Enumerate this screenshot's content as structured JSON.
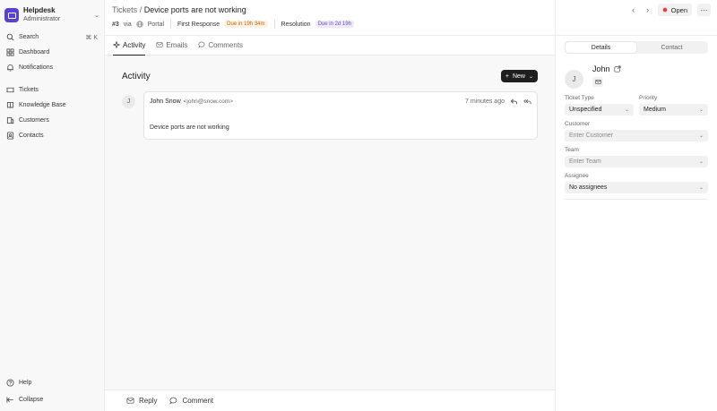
{
  "sidebar": {
    "brand_name": "Helpdesk",
    "brand_role": "Administrator",
    "search_label": "Search",
    "search_shortcut": "⌘ K",
    "items": [
      {
        "label": "Dashboard",
        "icon": "dashboard-icon"
      },
      {
        "label": "Notifications",
        "icon": "bell-icon"
      },
      {
        "label": "Tickets",
        "icon": "ticket-icon"
      },
      {
        "label": "Knowledge Base",
        "icon": "book-icon"
      },
      {
        "label": "Customers",
        "icon": "building-icon"
      },
      {
        "label": "Contacts",
        "icon": "contact-icon"
      }
    ],
    "help_label": "Help",
    "collapse_label": "Collapse"
  },
  "header": {
    "crumb_parent": "Tickets",
    "crumb_separator": "/",
    "crumb_title": "Device ports are not working",
    "ticket_no": "#3",
    "via": "via",
    "channel": "Portal",
    "first_response_label": "First Response",
    "first_response_due": "Due in 19h 34m",
    "resolution_label": "Resolution",
    "resolution_due": "Due in 2d 19h"
  },
  "tabs": [
    {
      "label": "Activity",
      "active": true
    },
    {
      "label": "Emails",
      "active": false
    },
    {
      "label": "Comments",
      "active": false
    }
  ],
  "activity": {
    "title": "Activity",
    "new_label": "New",
    "entry": {
      "avatar": "J",
      "name": "John Snow",
      "email": "<john@snow.com>",
      "time": "7 minutes ago",
      "body": "Device ports are not working"
    }
  },
  "reply_bar": {
    "reply_label": "Reply",
    "comment_label": "Comment"
  },
  "right": {
    "status_label": "Open",
    "status_color": "#d63b3b",
    "seg_details": "Details",
    "seg_contact": "Contact",
    "contact_avatar": "J",
    "contact_name": "John",
    "fields": {
      "ticket_type_label": "Ticket Type",
      "ticket_type_value": "Unspecified",
      "priority_label": "Priority",
      "priority_value": "Medium",
      "customer_label": "Customer",
      "customer_placeholder": "Enter Customer",
      "team_label": "Team",
      "team_placeholder": "Enter Team",
      "assignee_label": "Assignee",
      "assignee_value": "No assignees"
    }
  }
}
